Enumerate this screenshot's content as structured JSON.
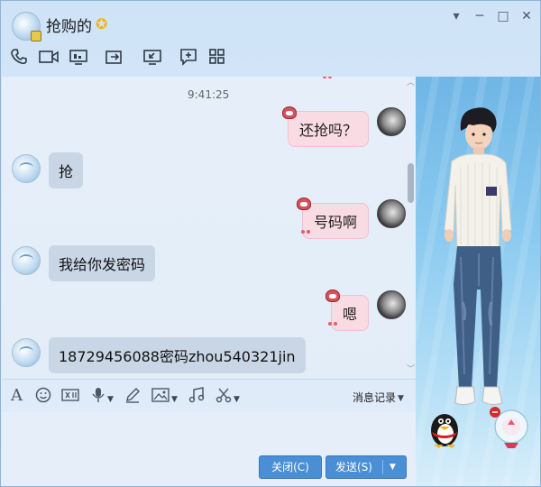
{
  "window": {
    "title": "抢购的",
    "controls": [
      "▼",
      "─",
      "□",
      "✕"
    ]
  },
  "toolbar": {
    "icons": [
      "phone-icon",
      "video-icon",
      "screen-share-icon",
      "file-transfer-icon",
      "remote-desktop-icon",
      "whiteboard-icon",
      "apps-icon"
    ]
  },
  "chat": {
    "timestamp": "9:41:25",
    "messages": [
      {
        "side": "right",
        "text": "还抢吗？"
      },
      {
        "side": "left",
        "text": "抢"
      },
      {
        "side": "right",
        "text": "号码啊"
      },
      {
        "side": "left",
        "text": "我给你发密码"
      },
      {
        "side": "right",
        "text": "嗯"
      },
      {
        "side": "left",
        "text": "18729456088密码zhou540321jin"
      }
    ]
  },
  "input_toolbar": {
    "icons": [
      "font-icon",
      "emoji-icon",
      "gif-icon",
      "voice-icon",
      "handwriting-icon",
      "image-icon",
      "music-icon",
      "screenshot-icon"
    ],
    "history_label": "消息记录"
  },
  "buttons": {
    "close_label": "关闭(C)",
    "send_label": "发送(S)"
  },
  "colors": {
    "accent": "#4a8fd6",
    "self_bubble": "#f9dbe3",
    "peer_bubble": "#c8d6e6"
  }
}
